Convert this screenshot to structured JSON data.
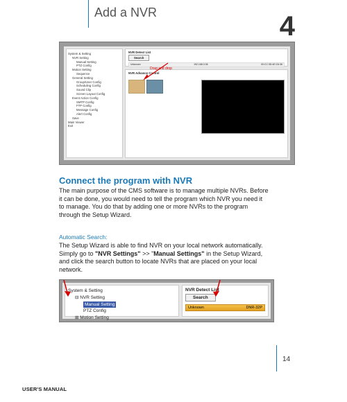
{
  "chapter": {
    "title": "Add a NVR",
    "number": "4"
  },
  "figure_main": {
    "tree": [
      "System & Setting",
      "NVR Setting",
      "Manual Setting",
      "PTZ Config",
      "Motion Setting",
      "Sequence",
      "General Setting",
      "Group/User Config",
      "Scheduling Config",
      "Sound Clip",
      "Screen Layout Config",
      "Event Action Config",
      "SMTP Config",
      "FTP Config",
      "Message Config",
      "Alert Config",
      "Save",
      "Main Viewer",
      "Exit"
    ],
    "detect_header": "NVR Detect List",
    "search_label": "Search",
    "found_name": "Unknown",
    "found_ip": "192.168.3.36",
    "found_mac": "00:CC:3D:4E:C6:36",
    "drag_label": "Drag and drop",
    "advance_header": "NVR Advance Control"
  },
  "section": {
    "heading": "Connect the program with NVR",
    "para1": "The main purpose of the CMS software is to manage multiple NVRs. Before it can be done, you would need to tell the program which NVR you need it to manage. You do that by adding one or more NVRs to the program through the Setup Wizard.",
    "subheading": "Automatic Search:",
    "para2_a": "The Setup Wizard is able to find NVR on your local network automatically. Simply go to ",
    "para2_b": "\"NVR Settings\"",
    "para2_c": " >> \"",
    "para2_d": "Manual Settings\"",
    "para2_e": " in the Setup Wizard, and click the search button to locate NVRs that are placed on your local network."
  },
  "figure_small": {
    "left_items": [
      "System & Setting",
      "NVR Setting",
      "Manual Setting",
      "PTZ Config",
      "Motion Setting"
    ],
    "right_header": "NVR Detect List",
    "search_label": "Search",
    "found_name": "Unknown",
    "found_ip": "DNR-32P"
  },
  "page": {
    "number": "14",
    "footer": "USER'S MANUAL"
  }
}
